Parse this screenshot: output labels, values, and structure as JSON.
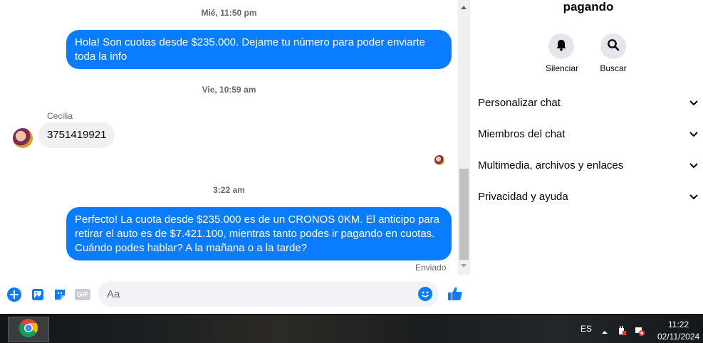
{
  "chat": {
    "timestamps": [
      "Mié, 11:50 pm",
      "Vie, 10:59 am",
      "3:22 am"
    ],
    "messages": [
      {
        "from": "me",
        "text_lines": [
          "Hola! Son cuotas desde $235.000. Dejame tu número para poder enviarte",
          "toda la info"
        ]
      },
      {
        "from": "Cecilia",
        "sender_name": "Cecilia",
        "text": "3751419921"
      },
      {
        "from": "me",
        "text_lines": [
          "Perfecto! La cuota desde $235.000 es de un CRONOS 0KM. El anticipo para",
          "retirar el auto es de $7.421.100, mientras tanto podes ir pagando en cuotas.",
          "Cuándo podes hablar? A la mañana o a la tarde?"
        ]
      }
    ],
    "status": "Enviado"
  },
  "composer": {
    "placeholder": "Aa",
    "icons": [
      "plus-icon",
      "image-icon",
      "sticker-icon",
      "gif-icon",
      "emoji-icon",
      "like-icon"
    ],
    "gif_label": "GIF"
  },
  "panel": {
    "title": "pagando",
    "actions": [
      {
        "label": "Silenciar",
        "icon": "bell-icon"
      },
      {
        "label": "Buscar",
        "icon": "search-icon"
      }
    ],
    "menu": [
      {
        "label": "Personalizar chat"
      },
      {
        "label": "Miembros del chat"
      },
      {
        "label": "Multimedia, archivos y enlaces"
      },
      {
        "label": "Privacidad y ayuda"
      }
    ]
  },
  "taskbar": {
    "language": "ES",
    "time": "11:22",
    "date": "02/11/2024",
    "app_icon": "chrome-icon"
  },
  "colors": {
    "accent": "#0a7cff",
    "incoming_bubble": "#f0f0f0",
    "button_bg": "#e4e6eb"
  }
}
